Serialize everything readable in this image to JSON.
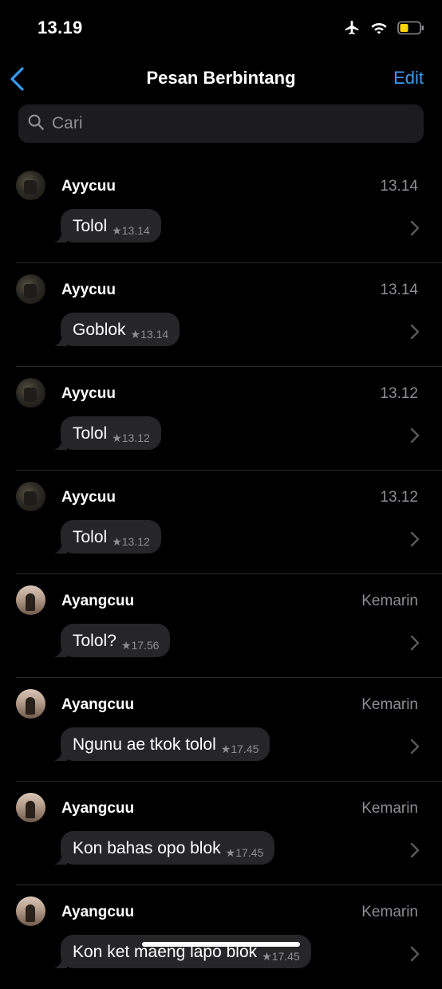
{
  "status_bar": {
    "time": "13.19",
    "icons": [
      "airplane-icon",
      "wifi-icon",
      "battery-icon"
    ],
    "battery_color": "#ffd60a"
  },
  "nav": {
    "title": "Pesan Berbintang",
    "edit_label": "Edit",
    "back_icon": "chevron-left-icon",
    "accent": "#3b9bf5"
  },
  "search": {
    "placeholder": "Cari",
    "value": ""
  },
  "messages": [
    {
      "sender": "Ayycuu",
      "date": "13.14",
      "text": "Tolol",
      "time": "13.14",
      "avatar": "dark"
    },
    {
      "sender": "Ayycuu",
      "date": "13.14",
      "text": "Goblok",
      "time": "13.14",
      "avatar": "dark"
    },
    {
      "sender": "Ayycuu",
      "date": "13.12",
      "text": "Tolol",
      "time": "13.12",
      "avatar": "dark"
    },
    {
      "sender": "Ayycuu",
      "date": "13.12",
      "text": "Tolol",
      "time": "13.12",
      "avatar": "dark"
    },
    {
      "sender": "Ayangcuu",
      "date": "Kemarin",
      "text": "Tolol?",
      "time": "17.56",
      "avatar": "light"
    },
    {
      "sender": "Ayangcuu",
      "date": "Kemarin",
      "text": "Ngunu ae tkok tolol",
      "time": "17.45",
      "avatar": "light"
    },
    {
      "sender": "Ayangcuu",
      "date": "Kemarin",
      "text": "Kon bahas opo blok",
      "time": "17.45",
      "avatar": "light"
    },
    {
      "sender": "Ayangcuu",
      "date": "Kemarin",
      "text": "Kon ket maeng lapo blok",
      "time": "17.45",
      "avatar": "light"
    }
  ]
}
